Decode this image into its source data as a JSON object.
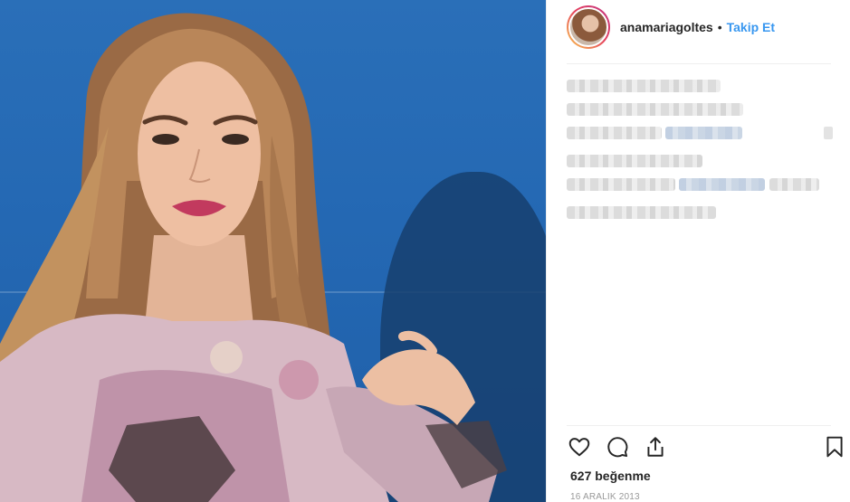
{
  "post": {
    "username": "anamariagoltes",
    "separator": "•",
    "follow_label": "Takip Et",
    "likes_text": "627 beğenme",
    "date_text": "16 ARALIK 2013"
  },
  "icons": {
    "like": "heart-icon",
    "comment": "comment-icon",
    "share": "share-icon",
    "save": "bookmark-icon"
  },
  "colors": {
    "accent": "#3897f0",
    "text": "#262626",
    "muted": "#999999",
    "photo_background": "#2468b3"
  }
}
